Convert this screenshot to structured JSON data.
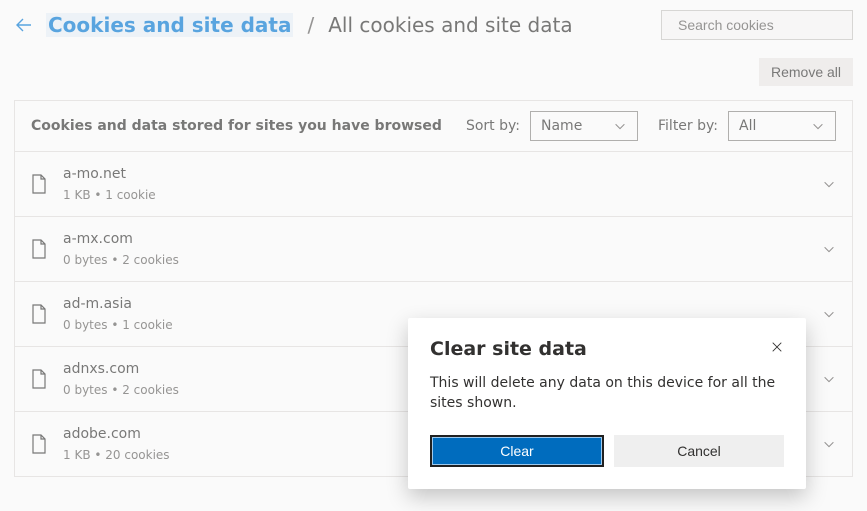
{
  "breadcrumb": {
    "parent": "Cookies and site data",
    "separator": "/",
    "current": "All cookies and site data"
  },
  "search": {
    "placeholder": "Search cookies"
  },
  "toolbar": {
    "remove_all": "Remove all"
  },
  "section": {
    "title": "Cookies and data stored for sites you have browsed",
    "sort_label": "Sort by:",
    "sort_value": "Name",
    "filter_label": "Filter by:",
    "filter_value": "All"
  },
  "rows": [
    {
      "site": "a-mo.net",
      "meta": "1 KB • 1 cookie"
    },
    {
      "site": "a-mx.com",
      "meta": "0 bytes • 2 cookies"
    },
    {
      "site": "ad-m.asia",
      "meta": "0 bytes • 1 cookie"
    },
    {
      "site": "adnxs.com",
      "meta": "0 bytes • 2 cookies"
    },
    {
      "site": "adobe.com",
      "meta": "1 KB • 20 cookies"
    }
  ],
  "dialog": {
    "title": "Clear site data",
    "body": "This will delete any data on this device for all the sites shown.",
    "primary": "Clear",
    "secondary": "Cancel"
  }
}
